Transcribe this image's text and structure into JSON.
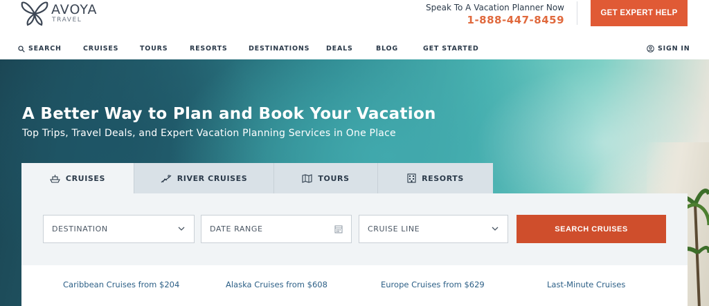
{
  "brand": {
    "name": "AVOYA",
    "tagline": "TRAVEL"
  },
  "contact": {
    "label": "Speak To A Vacation Planner Now",
    "phone": "1-888-447-8459"
  },
  "header": {
    "cta_label": "GET EXPERT HELP"
  },
  "nav": {
    "search": "SEARCH",
    "items": [
      "CRUISES",
      "TOURS",
      "RESORTS",
      "DESTINATIONS",
      "DEALS",
      "BLOG",
      "GET STARTED"
    ],
    "sign_in": "SIGN IN"
  },
  "hero": {
    "title": "A Better Way to Plan and Book Your Vacation",
    "subtitle": "Top Trips, Travel Deals, and Expert Vacation Planning Services in One Place"
  },
  "tabs": [
    {
      "label": "CRUISES",
      "icon": "ship-icon",
      "active": true
    },
    {
      "label": "RIVER CRUISES",
      "icon": "river-cruise-icon",
      "active": false
    },
    {
      "label": "TOURS",
      "icon": "map-icon",
      "active": false
    },
    {
      "label": "RESORTS",
      "icon": "building-icon",
      "active": false
    }
  ],
  "search_form": {
    "destination": "DESTINATION",
    "date_range": "DATE RANGE",
    "cruise_line": "CRUISE LINE",
    "submit": "SEARCH CRUISES"
  },
  "quick_links": [
    "Caribbean Cruises from $204",
    "Alaska Cruises from $608",
    "Europe Cruises from $629",
    "Last-Minute Cruises"
  ],
  "colors": {
    "accent": "#e05a35",
    "link": "#2c5f86",
    "text": "#2b3a4a"
  }
}
